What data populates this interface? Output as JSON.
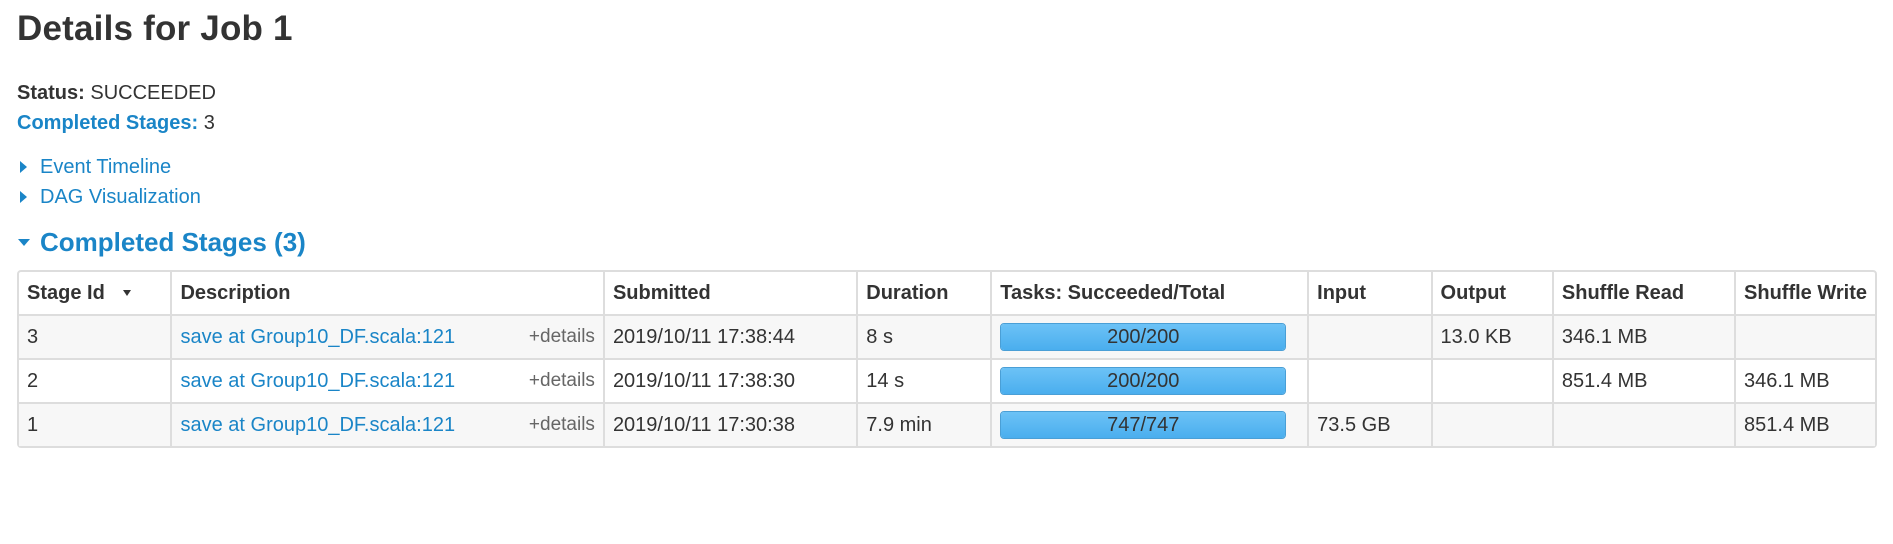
{
  "title": "Details for Job 1",
  "summary": {
    "status_label": "Status:",
    "status_value": "SUCCEEDED",
    "completed_label": "Completed Stages:",
    "completed_value": "3"
  },
  "toggles": {
    "event_timeline": "Event Timeline",
    "dag_visualization": "DAG Visualization"
  },
  "section": {
    "title": "Completed Stages (3)"
  },
  "table": {
    "headers": {
      "stage_id": "Stage Id",
      "description": "Description",
      "submitted": "Submitted",
      "duration": "Duration",
      "tasks": "Tasks: Succeeded/Total",
      "input": "Input",
      "output": "Output",
      "shuffle_read": "Shuffle Read",
      "shuffle_write": "Shuffle Write"
    },
    "rows": [
      {
        "stage_id": "3",
        "description": "save at Group10_DF.scala:121",
        "details": "+details",
        "submitted": "2019/10/11 17:38:44",
        "duration": "8 s",
        "tasks_text": "200/200",
        "tasks_fraction": 1.0,
        "input": "",
        "output": "13.0 KB",
        "shuffle_read": "346.1 MB",
        "shuffle_write": ""
      },
      {
        "stage_id": "2",
        "description": "save at Group10_DF.scala:121",
        "details": "+details",
        "submitted": "2019/10/11 17:38:30",
        "duration": "14 s",
        "tasks_text": "200/200",
        "tasks_fraction": 1.0,
        "input": "",
        "output": "",
        "shuffle_read": "851.4 MB",
        "shuffle_write": "346.1 MB"
      },
      {
        "stage_id": "1",
        "description": "save at Group10_DF.scala:121",
        "details": "+details",
        "submitted": "2019/10/11 17:30:38",
        "duration": "7.9 min",
        "tasks_text": "747/747",
        "tasks_fraction": 1.0,
        "input": "73.5 GB",
        "output": "",
        "shuffle_read": "",
        "shuffle_write": "851.4 MB"
      }
    ]
  },
  "colors": {
    "link": "#1a85c7",
    "progress_fill": "#4aaeee"
  }
}
